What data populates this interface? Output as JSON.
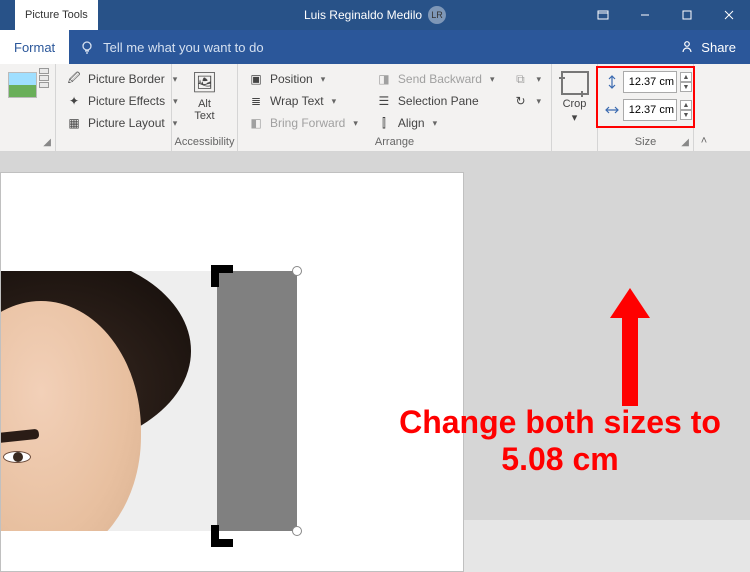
{
  "titlebar": {
    "context_tab": "Picture Tools",
    "user_name": "Luis Reginaldo Medilo",
    "user_initials": "LR"
  },
  "tabs": {
    "format": "Format",
    "tell_me": "Tell me what you want to do",
    "share": "Share"
  },
  "ribbon": {
    "adjust": {
      "picture_border": "Picture Border",
      "picture_effects": "Picture Effects",
      "picture_layout": "Picture Layout"
    },
    "accessibility": {
      "alt_text": "Alt\nText",
      "group": "Accessibility"
    },
    "arrange": {
      "position": "Position",
      "wrap_text": "Wrap Text",
      "bring_forward": "Bring Forward",
      "send_backward": "Send Backward",
      "selection_pane": "Selection Pane",
      "align": "Align",
      "group": "Arrange"
    },
    "crop": {
      "label": "Crop"
    },
    "size": {
      "height": "12.37 cm",
      "width": "12.37 cm",
      "group": "Size"
    }
  },
  "annotation": {
    "text": "Change both sizes to 5.08 cm"
  }
}
